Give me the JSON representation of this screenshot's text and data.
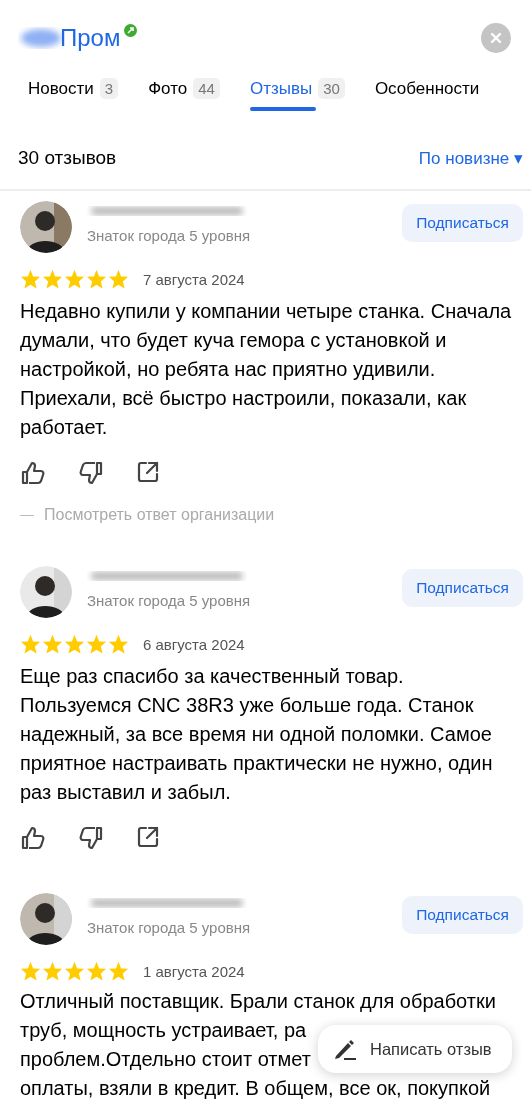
{
  "header": {
    "title": "Пром",
    "verified": true
  },
  "tabs": [
    {
      "label": "Новости",
      "count": "3",
      "selected": false
    },
    {
      "label": "Фото",
      "count": "44",
      "selected": false
    },
    {
      "label": "Отзывы",
      "count": "30",
      "selected": true
    },
    {
      "label": "Особенности",
      "selected": false
    }
  ],
  "reviews_header": {
    "count": "30 отзывов",
    "sort": "По новизне",
    "sort_caret": "▾"
  },
  "reviews": [
    {
      "author_level": "Знаток города 5 уровня",
      "subscribe": "Подписаться",
      "stars": 5,
      "date": "7 августа 2024",
      "text": "Недавно купили у компании четыре станка. Сначала думали, что будет куча гемора с установкой и настройкой, но ребята нас приятно удивили. Приехали, всё быстро настроили, показали, как работает.",
      "actions": true,
      "org_reply": "Посмотреть ответ организации"
    },
    {
      "author_level": "Знаток города 5 уровня",
      "subscribe": "Подписаться",
      "stars": 5,
      "date": "6 августа 2024",
      "text": "Еще раз спасибо за качественный товар. Пользуемся CNC 38R3 уже больше года. Станок надежный, за все время ни одной поломки. Самое приятное настраивать практически не нужно, один раз выставил и забыл.",
      "actions": true
    },
    {
      "author_level": "Знаток города 5 уровня",
      "subscribe": "Подписаться",
      "stars": 5,
      "date": "1 августа 2024",
      "lines": [
        "Отличный поставщик. Брали станок для обработки",
        "труб, мощность устраивает, ра",
        "проблем.Отдельно стоит отмет",
        "оплаты, взяли в кредит. В общем, все ок, покупкой"
      ],
      "actions": false
    }
  ],
  "write_button": {
    "label": "Написать отзыв"
  }
}
